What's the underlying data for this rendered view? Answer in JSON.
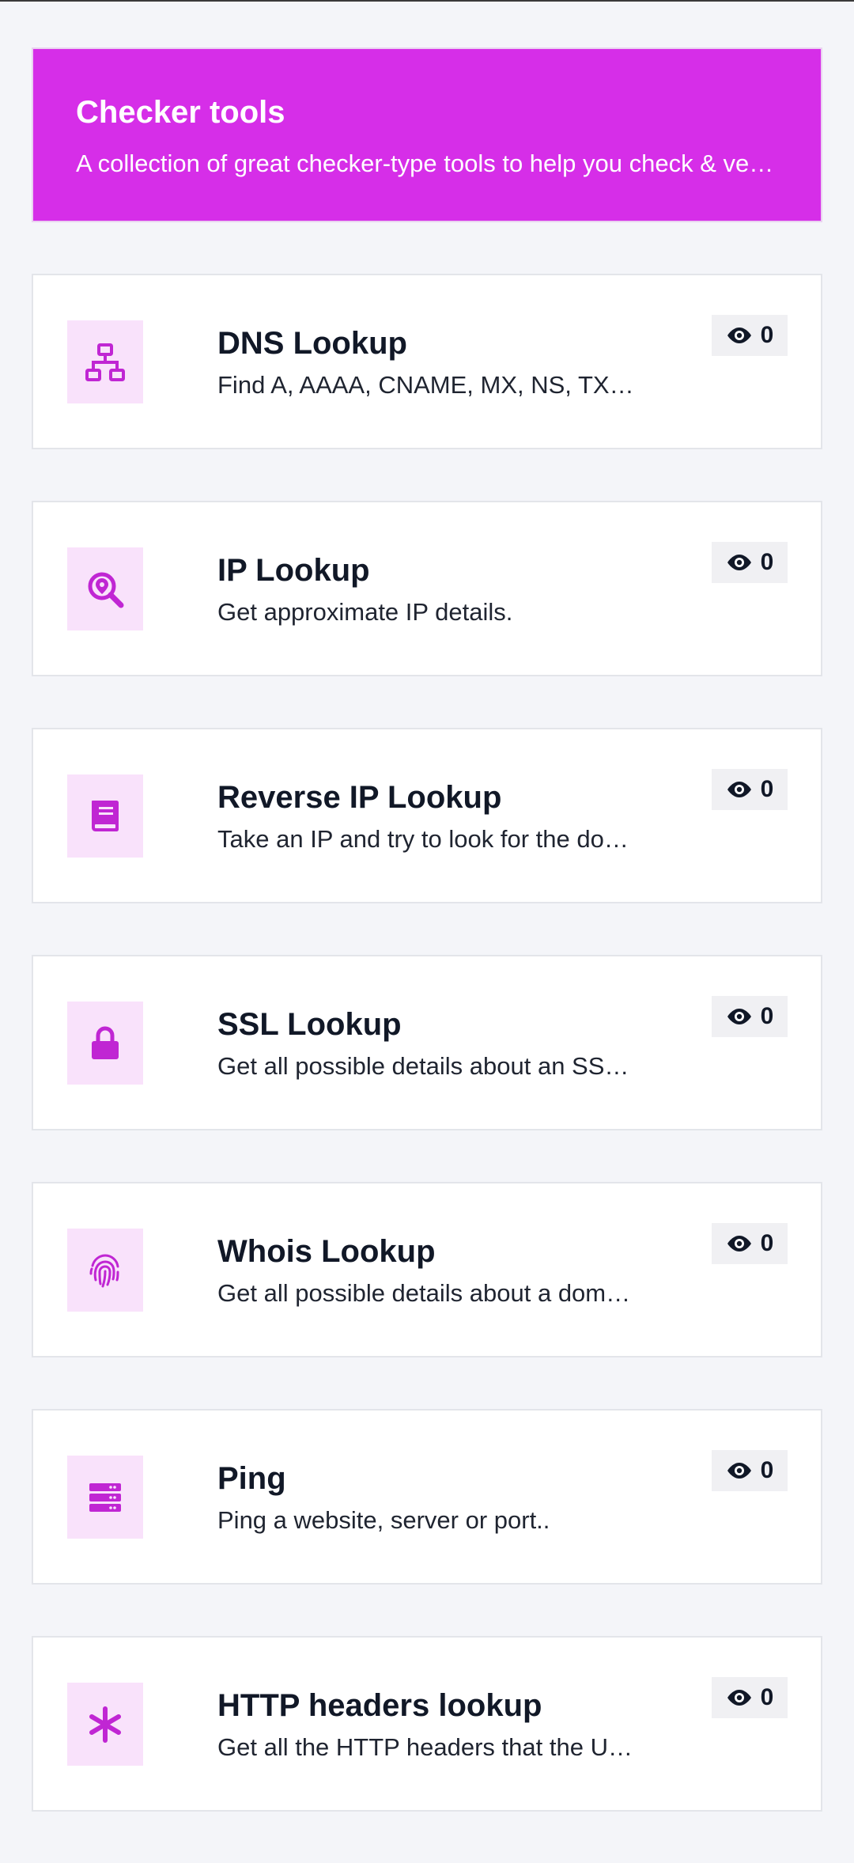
{
  "header": {
    "title": "Checker tools",
    "subtitle": "A collection of great checker-type tools to help you check & verify different things."
  },
  "accent_color": "#d62ee8",
  "icon_color": "#c026d3",
  "tools": [
    {
      "title": "DNS Lookup",
      "description": "Find A, AAAA, CNAME, MX, NS, TXT, SOA DNS records of a host.",
      "icon": "network-icon",
      "views": "0"
    },
    {
      "title": "IP Lookup",
      "description": "Get approximate IP details.",
      "icon": "search-location-icon",
      "views": "0"
    },
    {
      "title": "Reverse IP Lookup",
      "description": "Take an IP and try to look for the domain/host associated with it.",
      "icon": "book-icon",
      "views": "0"
    },
    {
      "title": "SSL Lookup",
      "description": "Get all possible details about an SSL certificate.",
      "icon": "lock-icon",
      "views": "0"
    },
    {
      "title": "Whois Lookup",
      "description": "Get all possible details about a domain name.",
      "icon": "fingerprint-icon",
      "views": "0"
    },
    {
      "title": "Ping",
      "description": "Ping a website, server or port..",
      "icon": "server-icon",
      "views": "0"
    },
    {
      "title": "HTTP headers lookup",
      "description": "Get all the HTTP headers that the URL returns on a normal GET request.",
      "icon": "asterisk-icon",
      "views": "0"
    }
  ]
}
